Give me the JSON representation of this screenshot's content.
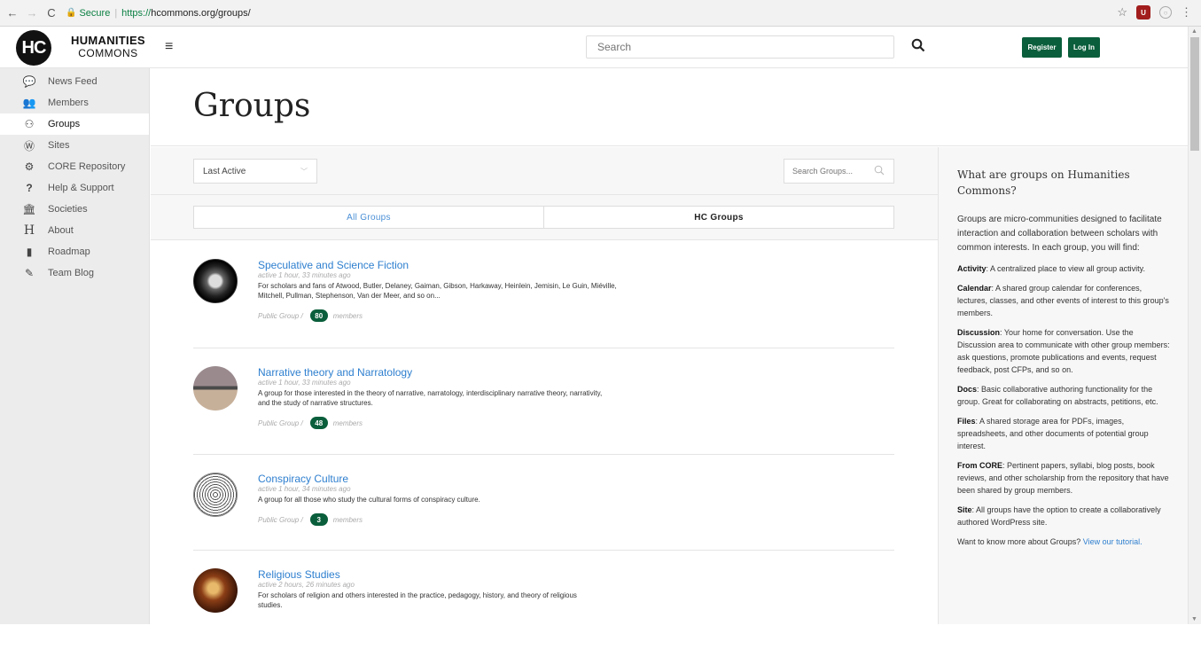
{
  "browser": {
    "secure_label": "Secure",
    "url_scheme": "https://",
    "url_rest": "hcommons.org/groups/"
  },
  "header": {
    "logo_mark": "HC",
    "logo_line1": "HUMANITIES",
    "logo_line2": "COMMONS",
    "search_placeholder": "Search",
    "register_label": "Register",
    "login_label": "Log In"
  },
  "sidebar": {
    "items": [
      {
        "label": "News Feed",
        "icon": "comments-icon",
        "glyph": "💬"
      },
      {
        "label": "Members",
        "icon": "users-icon",
        "glyph": "👥"
      },
      {
        "label": "Groups",
        "icon": "groups-icon",
        "glyph": "⚇"
      },
      {
        "label": "Sites",
        "icon": "wordpress-icon",
        "glyph": "Ⓦ"
      },
      {
        "label": "CORE Repository",
        "icon": "cogs-icon",
        "glyph": "⚙"
      },
      {
        "label": "Help & Support",
        "icon": "question-icon",
        "glyph": "?"
      },
      {
        "label": "Societies",
        "icon": "institution-icon",
        "glyph": "🏛"
      },
      {
        "label": "About",
        "icon": "h-icon",
        "glyph": "H"
      },
      {
        "label": "Roadmap",
        "icon": "map-icon",
        "glyph": "▮"
      },
      {
        "label": "Team Blog",
        "icon": "edit-icon",
        "glyph": "✎"
      }
    ]
  },
  "main": {
    "title": "Groups",
    "order_select": "Last Active",
    "group_search_placeholder": "Search Groups...",
    "tabs": [
      {
        "label": "All Groups"
      },
      {
        "label": "HC Groups"
      }
    ],
    "groups": [
      {
        "name": "Speculative and Science Fiction",
        "active": "active 1 hour, 33 minutes ago",
        "desc1": "For scholars and fans of Atwood, Butler, Delaney, Gaiman, Gibson, Harkaway, Heinlein, Jemisin, Le Guin, Miéville,",
        "desc2": "Mitchell, Pullman, Stephenson, Van der Meer, and so on...",
        "type": "Public Group /",
        "members": "80",
        "members_label": "members"
      },
      {
        "name": "Narrative theory and Narratology",
        "active": "active 1 hour, 33 minutes ago",
        "desc1": "A group for those interested in the theory of narrative, narratology, interdisciplinary narrative theory, narrativity,",
        "desc2": "and the study of narrative structures.",
        "type": "Public Group /",
        "members": "48",
        "members_label": "members"
      },
      {
        "name": "Conspiracy Culture",
        "active": "active 1 hour, 34 minutes ago",
        "desc1": "A group for all those who study the cultural forms of conspiracy culture.",
        "desc2": "",
        "type": "Public Group /",
        "members": "3",
        "members_label": "members"
      },
      {
        "name": "Religious Studies",
        "active": "active 2 hours, 26 minutes ago",
        "desc1": "For scholars of religion and others interested in the practice, pedagogy, history, and theory of religious",
        "desc2": "studies.",
        "type": "",
        "members": "",
        "members_label": ""
      }
    ]
  },
  "info": {
    "title": "What are groups on Humanities Commons?",
    "intro": "Groups are micro-communities designed to facilitate interaction and collaboration between scholars with common interests. In each group, you will find:",
    "features": [
      {
        "term": "Activity",
        "text": ": A centralized place to view all group activity."
      },
      {
        "term": "Calendar",
        "text": ": A shared group calendar for conferences, lectures, classes, and other events of interest to this group's members."
      },
      {
        "term": "Discussion",
        "text": ": Your home for conversation. Use the Discussion area to communicate with other group members: ask questions, promote publications and events, request feedback, post CFPs, and so on."
      },
      {
        "term": "Docs",
        "text": ": Basic collaborative authoring functionality for the group. Great for collaborating on abstracts, petitions, etc."
      },
      {
        "term": "Files",
        "text": ": A shared storage area for PDFs, images, spreadsheets, and other documents of potential group interest."
      },
      {
        "term": "From CORE",
        "text": ": Pertinent papers, syllabi, blog posts, book reviews, and other scholarship from the repository that have been shared by group members."
      },
      {
        "term": "Site",
        "text": ": All groups have the option to create a collaboratively authored WordPress site."
      }
    ],
    "outro": "Want to know more about Groups?",
    "outro_link": "View our tutorial."
  },
  "colors": {
    "brand_green": "#0a5e3b",
    "link_blue": "#2e7fcf"
  }
}
